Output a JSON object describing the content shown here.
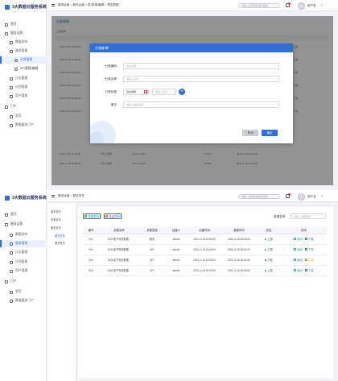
{
  "app_title": "3大数据云服务系统",
  "colors": {
    "accent": "#2f6fd8",
    "online": "#2fb344",
    "offline": "#e33",
    "edit": "#2fb3a0",
    "warn": "#f0962d"
  },
  "nav": {
    "home": "首页",
    "service_ops": "服务运营",
    "data_publish": "数据发布",
    "service_mgmt": "服务管理",
    "category_mgmt": "分类管理",
    "api_mgmt": "API管理/编辑",
    "log_mgmt": "日志管理",
    "plan_mgmt": "计划管理",
    "user_mgmt": "用户管理",
    "portal": "门户",
    "homepage": "首页",
    "portal_service": "数据服务门户"
  },
  "nav_bottom": {
    "home": "首页",
    "service_ops": "服务运营",
    "data_publish": "数据发布",
    "service_mgmt": "服务管理",
    "log_mgmt": "日志管理",
    "plan_mgmt": "计划管理",
    "user_mgmt": "用户管理",
    "portal": "门户",
    "homepage": "首页",
    "portal_service": "数据服务门户"
  },
  "top": {
    "breadcrumb": "服务运营 > 服务运营 > 表-新增/编辑 > 预览数据",
    "search_placeholder": "请输入资源名称进行查询",
    "username": "用户名",
    "bg_tab": "分类管理",
    "bg_toolbar": "上架选择"
  },
  "modal": {
    "title": "分类新增",
    "name_label": "分类编码:",
    "name_placeholder": "请先选择",
    "code_label": "分类名称:",
    "code_placeholder": "请输入名称",
    "icon_label": "分类标签:",
    "icon_btn": "请先选择",
    "icon_placeholder": "请输入标签",
    "desc_label": "备注:",
    "desc_placeholder": "请输入描述内容",
    "cancel": "取消",
    "confirm": "确定"
  },
  "bg_rows": [
    [
      "2021-4-15 15:00:00",
      "上架"
    ],
    [
      "2021-4-15 15:00:00",
      "上架"
    ],
    [
      "2021-4-15 15:00:00",
      "上架"
    ],
    [
      "2021-4-15 15:00:00",
      "上架"
    ],
    [
      "2021-4-15 15:00:00",
      "上架"
    ],
    [
      "2021-4-15 15:00:00",
      "上架"
    ]
  ],
  "bg_tail": [
    {
      "name": "广东工商局",
      "type": "Android APP",
      "code": "23448",
      "time": "2021-4-15 15:00:00"
    },
    {
      "name": "广东工商局",
      "type": "Android APP",
      "code": "23448",
      "time": "2021-4-15 15:00:00"
    }
  ],
  "bottom_bar": {
    "breadcrumb": "服务运营 > 服务发布",
    "search_placeholder": "请输入资源名称进行查询",
    "username": "用户名",
    "tab_active": "服务发布",
    "btn_publish": "资源发布",
    "btn_batch": "批量操作",
    "filter_label": "资源名称:",
    "filter_placeholder": "请输入资源名称",
    "sub_items": [
      "服务发布",
      "资源发布",
      "服务发布",
      "服务发布",
      "服务发布"
    ]
  },
  "table": {
    "headers": [
      "编号",
      "资源名称",
      "资源类型",
      "创建人",
      "创建时间",
      "更新时间",
      "状态",
      "操作"
    ],
    "rows": [
      {
        "id": "001",
        "name": "2021电子商务数据...",
        "type": "服务",
        "creator": "admin",
        "created": "2021-4-15 15:00:00",
        "updated": "2021-4-15 15:00:00",
        "status": "上架",
        "ops": [
          "编辑",
          "下架"
        ]
      },
      {
        "id": "002",
        "name": "2021电子商务数据...",
        "type": "API",
        "creator": "admin",
        "created": "2021-4-15 15:00:00",
        "updated": "2021-4-15 15:00:00",
        "status": "上架",
        "ops": [
          "编辑",
          "下架"
        ]
      },
      {
        "id": "003",
        "name": "2021电子商务数据...",
        "type": "API",
        "creator": "admin",
        "created": "2021-4-15 15:00:00",
        "updated": "2021-4-15 15:00:00",
        "status": "下架",
        "ops": [
          "编辑",
          "上架"
        ]
      },
      {
        "id": "004",
        "name": "2021电子商务数据...",
        "type": "API",
        "creator": "admin",
        "created": "2021-4-15 15:00:00",
        "updated": "2021-4-15 15:00:00",
        "status": "上架",
        "ops": [
          "编辑",
          "下架"
        ]
      }
    ]
  }
}
